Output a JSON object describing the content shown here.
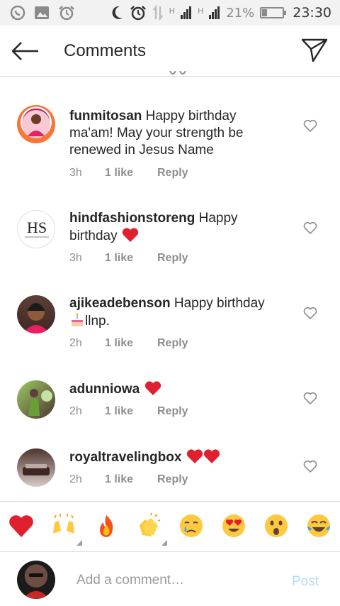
{
  "status_bar": {
    "battery": "21%",
    "time": "23:30",
    "signal_1": "H",
    "signal_2": "H"
  },
  "header": {
    "title": "Comments"
  },
  "comments": [
    {
      "username": "funmitosan",
      "text": " Happy birthday ma'am! May your strength be renewed in Jesus Name",
      "time": "3h",
      "likes": "1 like",
      "reply": "Reply"
    },
    {
      "username": "hindfashionstoreng",
      "text": " Happy birthday ",
      "time": "3h",
      "likes": "1 like",
      "reply": "Reply",
      "avatar_text": "HS"
    },
    {
      "username": "ajikeadebenson",
      "text": " Happy birthday",
      "text_after_emoji": "llnp.",
      "time": "2h",
      "likes": "1 like",
      "reply": "Reply"
    },
    {
      "username": "adunniowa",
      "text": " ",
      "time": "2h",
      "likes": "1 like",
      "reply": "Reply"
    },
    {
      "username": "royaltravelingbox",
      "text": " ",
      "time": "2h",
      "likes": "1 like",
      "reply": "Reply"
    }
  ],
  "emoji_bar": [
    "red-heart",
    "raising-hands",
    "fire",
    "clapping-hands",
    "crying-face",
    "heart-eyes",
    "astonished-face",
    "tears-of-joy"
  ],
  "compose": {
    "placeholder": "Add a comment…",
    "post_label": "Post"
  },
  "colors": {
    "heart": "#e0202e",
    "muted": "#8e8e8e",
    "post": "#b3dbff"
  }
}
